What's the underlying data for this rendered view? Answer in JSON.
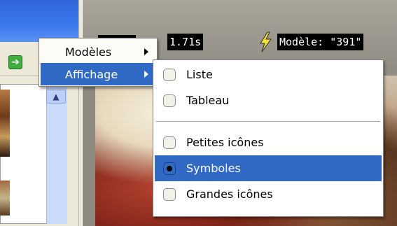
{
  "viewer": {
    "time": "1.71s",
    "model": "Modèle: \"391\"",
    "icons": {
      "left_button": "arrow-right-icon",
      "scroll_up": "chevron-up-icon",
      "bolt": "lightning-icon"
    }
  },
  "menu": {
    "items": [
      {
        "label": "Modèles",
        "highlighted": false,
        "has_submenu": true
      },
      {
        "label": "Affichage",
        "highlighted": true,
        "has_submenu": true
      }
    ]
  },
  "submenu": {
    "view_group": [
      {
        "label": "Liste",
        "checked": false
      },
      {
        "label": "Tableau",
        "checked": false
      }
    ],
    "size_group": [
      {
        "label": "Petites icônes",
        "checked": false
      },
      {
        "label": "Symboles",
        "checked": true
      },
      {
        "label": "Grandes icônes",
        "checked": false
      }
    ]
  },
  "colors": {
    "highlight": "#316ac5",
    "menu_bg": "#fdfcf7",
    "panel": "#ece9d8"
  }
}
